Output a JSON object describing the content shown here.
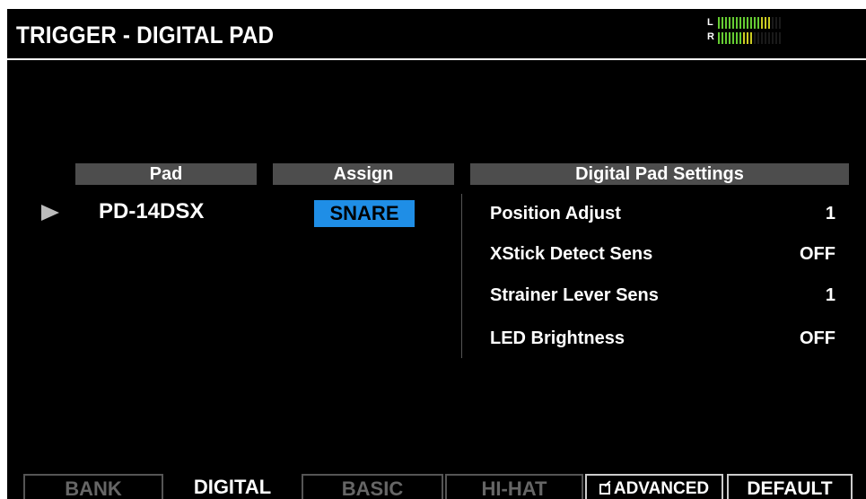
{
  "header": {
    "title": "TRIGGER - DIGITAL PAD"
  },
  "meter": {
    "left_label": "L",
    "right_label": "R",
    "left_level": 0.82,
    "right_level": 0.55
  },
  "columns": {
    "pad": "Pad",
    "assign": "Assign",
    "settings": "Digital Pad Settings"
  },
  "pad": {
    "value": "PD-14DSX"
  },
  "assign": {
    "value": "SNARE"
  },
  "settings": [
    {
      "label": "Position Adjust",
      "value": "1"
    },
    {
      "label": "XStick Detect Sens",
      "value": "OFF"
    },
    {
      "label": "Strainer Lever Sens",
      "value": "1"
    },
    {
      "label": "LED Brightness",
      "value": "OFF"
    }
  ],
  "tabs": [
    "BANK",
    "DIGITAL",
    "BASIC",
    "HI-HAT",
    "ADVANCED",
    "DEFAULT"
  ],
  "colors": {
    "accent": "#1f8ee6",
    "background": "#000000",
    "header_bar": "#4d4d4d"
  }
}
